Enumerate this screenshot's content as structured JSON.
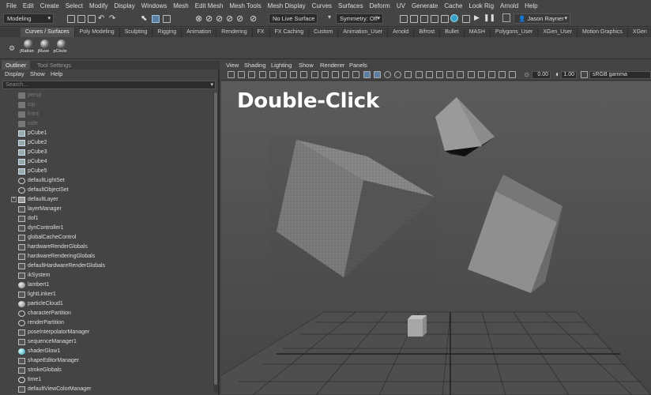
{
  "menubar": [
    "File",
    "Edit",
    "Create",
    "Select",
    "Modify",
    "Display",
    "Windows",
    "Mesh",
    "Edit Mesh",
    "Mesh Tools",
    "Mesh Display",
    "Curves",
    "Surfaces",
    "Deform",
    "UV",
    "Generate",
    "Cache",
    "Look Rig",
    "Arnold",
    "Help"
  ],
  "statusline": {
    "mode": "Modeling",
    "live_surface": "No Live Surface",
    "symmetry": "Symmetry: Off",
    "user": "Jason Rayner"
  },
  "shelf_tabs": [
    "Curves / Surfaces",
    "Poly Modeling",
    "Sculpting",
    "Rigging",
    "Animation",
    "Rendering",
    "FX",
    "FX Caching",
    "Custom",
    "Animation_User",
    "Arnold",
    "Bifrost",
    "Bullet",
    "MASH",
    "Polygons_User",
    "XGen_User",
    "Motion Graphics",
    "XGen"
  ],
  "shelf_buttons": [
    "jRattan",
    "jRuve",
    "pCircle"
  ],
  "outliner": {
    "tabs": [
      "Outliner",
      "Tool Settings"
    ],
    "menu": [
      "Display",
      "Show",
      "Help"
    ],
    "search_placeholder": "Search...",
    "items": [
      {
        "label": "persp",
        "dim": true,
        "icon": "camera-icon"
      },
      {
        "label": "top",
        "dim": true,
        "icon": "camera-icon"
      },
      {
        "label": "front",
        "dim": true,
        "icon": "camera-icon"
      },
      {
        "label": "side",
        "dim": true,
        "icon": "camera-icon"
      },
      {
        "label": "pCube1",
        "icon": "mesh-icon"
      },
      {
        "label": "pCube2",
        "icon": "mesh-icon"
      },
      {
        "label": "pCube3",
        "icon": "mesh-icon"
      },
      {
        "label": "pCube4",
        "icon": "mesh-icon"
      },
      {
        "label": "pCube5",
        "icon": "mesh-icon"
      },
      {
        "label": "defaultLightSet",
        "icon": "set-icon"
      },
      {
        "label": "defaultObjectSet",
        "icon": "set-icon"
      },
      {
        "label": "defaultLayer",
        "icon": "layer-icon",
        "expand": true
      },
      {
        "label": "layerManager",
        "icon": "node-icon"
      },
      {
        "label": "dof1",
        "icon": "node-icon"
      },
      {
        "label": "dynController1",
        "icon": "node-icon"
      },
      {
        "label": "globalCacheControl",
        "icon": "node-icon"
      },
      {
        "label": "hardwareRenderGlobals",
        "icon": "node-icon"
      },
      {
        "label": "hardwareRenderingGlobals",
        "icon": "node-icon"
      },
      {
        "label": "defaultHardwareRenderGlobals",
        "icon": "node-icon"
      },
      {
        "label": "ikSystem",
        "icon": "node-icon"
      },
      {
        "label": "lambert1",
        "icon": "shader-icon"
      },
      {
        "label": "lightLinker1",
        "icon": "node-icon"
      },
      {
        "label": "particleCloud1",
        "icon": "shader-icon"
      },
      {
        "label": "characterPartition",
        "icon": "set-icon"
      },
      {
        "label": "renderPartition",
        "icon": "set-icon"
      },
      {
        "label": "poseInterpolatorManager",
        "icon": "node-icon"
      },
      {
        "label": "sequenceManager1",
        "icon": "node-icon"
      },
      {
        "label": "shaderGlow1",
        "icon": "glow-icon"
      },
      {
        "label": "shapeEditorManager",
        "icon": "node-icon"
      },
      {
        "label": "strokeGlobals",
        "icon": "node-icon"
      },
      {
        "label": "time1",
        "icon": "clock-icon"
      },
      {
        "label": "defaultViewColorManager",
        "icon": "node-icon"
      }
    ]
  },
  "viewport": {
    "menu": [
      "View",
      "Shading",
      "Lighting",
      "Show",
      "Renderer",
      "Panels"
    ],
    "field_a": "0.00",
    "field_b": "1.00",
    "color_space": "sRGB gamma",
    "overlay_text": "Double-Click"
  }
}
